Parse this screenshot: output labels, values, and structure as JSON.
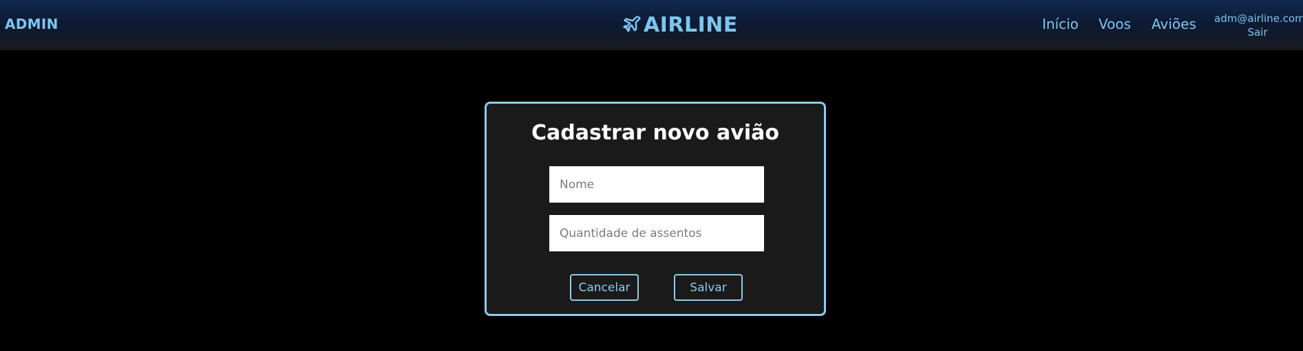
{
  "navbar": {
    "brand_left": "ADMIN",
    "logo": {
      "icon": "plane-icon",
      "text": "AIRLINE"
    },
    "links": [
      {
        "label": "Início"
      },
      {
        "label": "Voos"
      },
      {
        "label": "Aviões"
      }
    ],
    "user": {
      "email": "adm@airline.com",
      "logout": "Sair"
    }
  },
  "form": {
    "title": "Cadastrar novo avião",
    "name_placeholder": "Nome",
    "seats_placeholder": "Quantidade de assentos",
    "cancel_label": "Cancelar",
    "save_label": "Salvar"
  },
  "colors": {
    "accent": "#7cc6ef",
    "card_border": "#8ecdf0",
    "card_bg": "#1a1a1a",
    "page_bg": "#000000"
  }
}
